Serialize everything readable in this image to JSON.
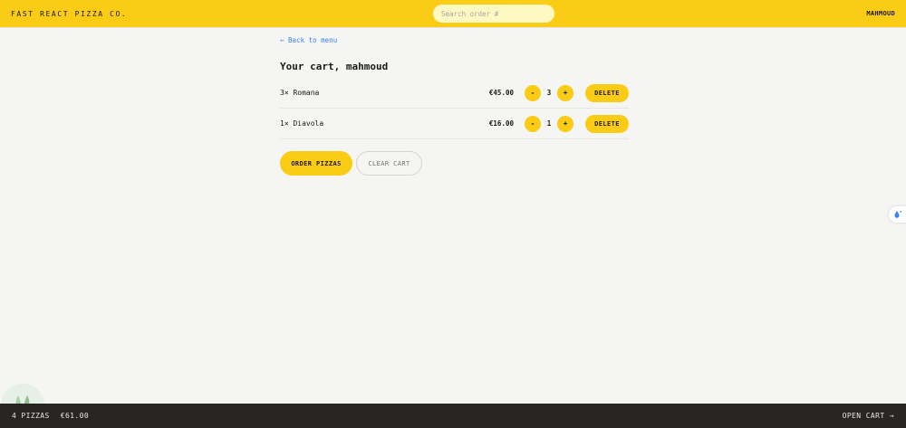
{
  "header": {
    "logo": "Fast React Pizza Co.",
    "search_placeholder": "Search order #",
    "username": "mahmoud"
  },
  "main": {
    "back_link": "← Back to menu",
    "title": "Your cart, mahmoud",
    "items": [
      {
        "name": "3× Romana",
        "price": "€45.00",
        "quantity": "3",
        "decrease": "-",
        "increase": "+",
        "delete": "Delete"
      },
      {
        "name": "1× Diavola",
        "price": "€16.00",
        "quantity": "1",
        "decrease": "-",
        "increase": "+",
        "delete": "Delete"
      }
    ],
    "order_button": "Order pizzas",
    "clear_button": "Clear cart"
  },
  "footer": {
    "pizza_count": "4 pizzas",
    "total": "€61.00",
    "open_cart": "Open cart →"
  },
  "colors": {
    "accent": "#facc15",
    "background": "#f5f5f4",
    "footer": "#292524",
    "link": "#3b82f6"
  },
  "icons": {
    "side_widget": "water-drop-icon",
    "corner": "leaf-logo-icon"
  }
}
